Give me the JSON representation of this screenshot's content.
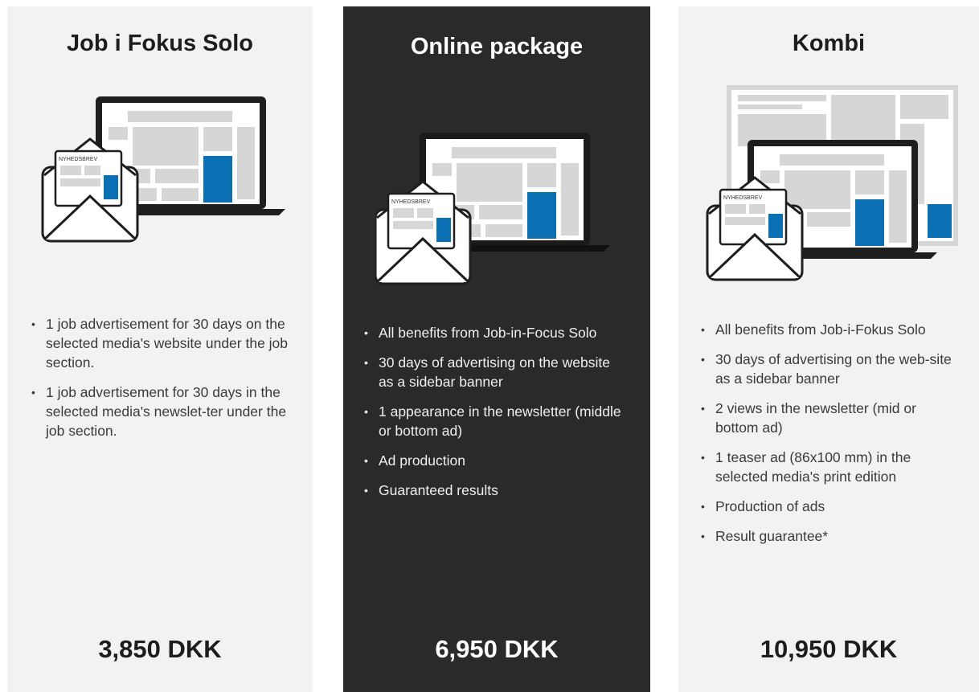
{
  "cards": [
    {
      "title": "Job i Fokus Solo",
      "newsletter_label": "NYHEDSBREV",
      "features": [
        "1 job advertisement for 30 days on the selected media's website under the job section.",
        "1 job advertisement for 30 days in the selected media's newslet-ter under the job section."
      ],
      "price": "3,850 DKK"
    },
    {
      "title": "Online package",
      "newsletter_label": "NYHEDSBREV",
      "features": [
        "All benefits from Job-in-Focus Solo",
        "30 days of advertising on the website as a sidebar banner",
        "1 appearance in the newsletter (middle or bottom ad)",
        "Ad production",
        "Guaranteed results"
      ],
      "price": "6,950 DKK"
    },
    {
      "title": "Kombi",
      "newsletter_label": "NYHEDSBREV",
      "features": [
        "All benefits from Job-i-Fokus Solo",
        "30 days of advertising on the web-site as a sidebar banner",
        "2 views in the newsletter (mid or bottom ad)",
        "1 teaser ad (86x100 mm) in the selected media's print edition",
        "Production of ads",
        "Result guarantee*"
      ],
      "price": "10,950 DKK"
    }
  ],
  "colors": {
    "card_bg": "#f2f2f2",
    "featured_bg": "#2b2a2b",
    "accent_blue": "#0a6fb3",
    "screen_placeholder": "#d6d6d6"
  }
}
